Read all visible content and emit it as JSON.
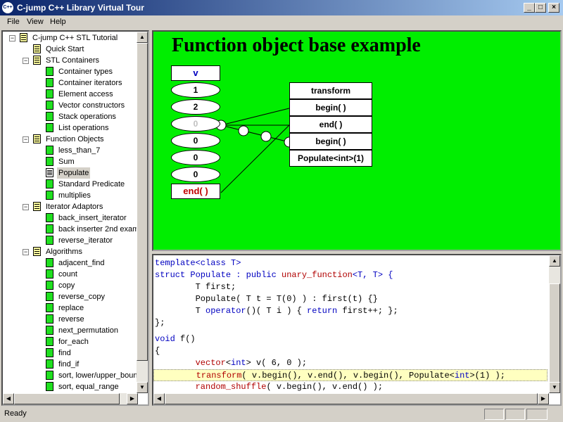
{
  "window": {
    "title": "C-jump C++ Library Virtual Tour",
    "minimize": "_",
    "maximize": "□",
    "close": "×"
  },
  "menu": [
    "File",
    "View",
    "Help"
  ],
  "tree": {
    "items": [
      {
        "label": "C-jump C++ STL Tutorial",
        "level": 0,
        "type": "book",
        "expander": "−"
      },
      {
        "label": "Quick Start",
        "level": 1,
        "type": "book"
      },
      {
        "label": "STL Containers",
        "level": 1,
        "type": "book",
        "expander": "−"
      },
      {
        "label": "Container types",
        "level": 2,
        "type": "page"
      },
      {
        "label": "Container iterators",
        "level": 2,
        "type": "page"
      },
      {
        "label": "Element access",
        "level": 2,
        "type": "page"
      },
      {
        "label": "Vector constructors",
        "level": 2,
        "type": "page"
      },
      {
        "label": "Stack operations",
        "level": 2,
        "type": "page"
      },
      {
        "label": "List operations",
        "level": 2,
        "type": "page"
      },
      {
        "label": "Function Objects",
        "level": 1,
        "type": "book",
        "expander": "−"
      },
      {
        "label": "less_than_7",
        "level": 2,
        "type": "page"
      },
      {
        "label": "Sum",
        "level": 2,
        "type": "page"
      },
      {
        "label": "Populate",
        "level": 2,
        "type": "page-sel",
        "selected": true
      },
      {
        "label": "Standard Predicate",
        "level": 2,
        "type": "page"
      },
      {
        "label": "multiplies",
        "level": 2,
        "type": "page"
      },
      {
        "label": "Iterator Adaptors",
        "level": 1,
        "type": "book",
        "expander": "−"
      },
      {
        "label": "back_insert_iterator",
        "level": 2,
        "type": "page"
      },
      {
        "label": "back inserter 2nd exam",
        "level": 2,
        "type": "page"
      },
      {
        "label": "reverse_iterator",
        "level": 2,
        "type": "page"
      },
      {
        "label": "Algorithms",
        "level": 1,
        "type": "book",
        "expander": "−"
      },
      {
        "label": "adjacent_find",
        "level": 2,
        "type": "page"
      },
      {
        "label": "count",
        "level": 2,
        "type": "page"
      },
      {
        "label": "copy",
        "level": 2,
        "type": "page"
      },
      {
        "label": "reverse_copy",
        "level": 2,
        "type": "page"
      },
      {
        "label": "replace",
        "level": 2,
        "type": "page"
      },
      {
        "label": "reverse",
        "level": 2,
        "type": "page"
      },
      {
        "label": "next_permutation",
        "level": 2,
        "type": "page"
      },
      {
        "label": "for_each",
        "level": 2,
        "type": "page"
      },
      {
        "label": "find",
        "level": 2,
        "type": "page"
      },
      {
        "label": "find_if",
        "level": 2,
        "type": "page"
      },
      {
        "label": "sort, lower/upper_boun",
        "level": 2,
        "type": "page"
      },
      {
        "label": "sort, equal_range",
        "level": 2,
        "type": "page"
      }
    ]
  },
  "diagram": {
    "title": "Function object base example",
    "vector_label": "v",
    "vector_cells": [
      "1",
      "2",
      "0",
      "0",
      "0",
      "0"
    ],
    "end_label": "end( )",
    "functions": [
      "transform",
      "begin( )",
      "end( )",
      "begin( )",
      "Populate<int>(1)"
    ],
    "colors": {
      "background": "#00ee00",
      "vector_label": "#0000c0",
      "end_label": "#c00000",
      "faded": "#c0c0c0"
    }
  },
  "code": {
    "lines": [
      [
        {
          "t": "template<class T>",
          "c": "kw"
        }
      ],
      [
        {
          "t": "struct Populate : public ",
          "c": "kw"
        },
        {
          "t": "unary_function",
          "c": "tp"
        },
        {
          "t": "<T, T> {",
          "c": "kw"
        }
      ],
      [
        {
          "t": "        T first;",
          "c": "plain"
        }
      ],
      [
        {
          "t": "        Populate( T t = T(0) ) : first(t) {}",
          "c": "plain"
        }
      ],
      [
        {
          "t": "        T ",
          "c": "plain"
        },
        {
          "t": "operator",
          "c": "kw"
        },
        {
          "t": "()( T i ) { ",
          "c": "plain"
        },
        {
          "t": "return",
          "c": "kw"
        },
        {
          "t": " first++; };",
          "c": "plain"
        }
      ],
      [
        {
          "t": "};",
          "c": "plain"
        }
      ],
      [
        {
          "t": "void",
          "c": "kw"
        },
        {
          "t": " f()",
          "c": "plain"
        }
      ],
      [
        {
          "t": "{",
          "c": "plain"
        }
      ],
      [
        {
          "t": "        ",
          "c": "plain"
        },
        {
          "t": "vector",
          "c": "tp"
        },
        {
          "t": "<",
          "c": "plain"
        },
        {
          "t": "int",
          "c": "kw"
        },
        {
          "t": "> v( 6, 0 );",
          "c": "plain"
        }
      ],
      [
        {
          "t": "        ",
          "c": "plain"
        },
        {
          "t": "transform",
          "c": "tp"
        },
        {
          "t": "( v.begin(), v.end(), v.begin(), Populate<",
          "c": "plain"
        },
        {
          "t": "int",
          "c": "kw"
        },
        {
          "t": ">(1) );",
          "c": "plain"
        }
      ],
      [
        {
          "t": "        ",
          "c": "plain"
        },
        {
          "t": "random_shuffle",
          "c": "tp"
        },
        {
          "t": "( v.begin(), v.end() );",
          "c": "plain"
        }
      ]
    ],
    "highlight_line": 9
  },
  "status": {
    "text": "Ready"
  }
}
